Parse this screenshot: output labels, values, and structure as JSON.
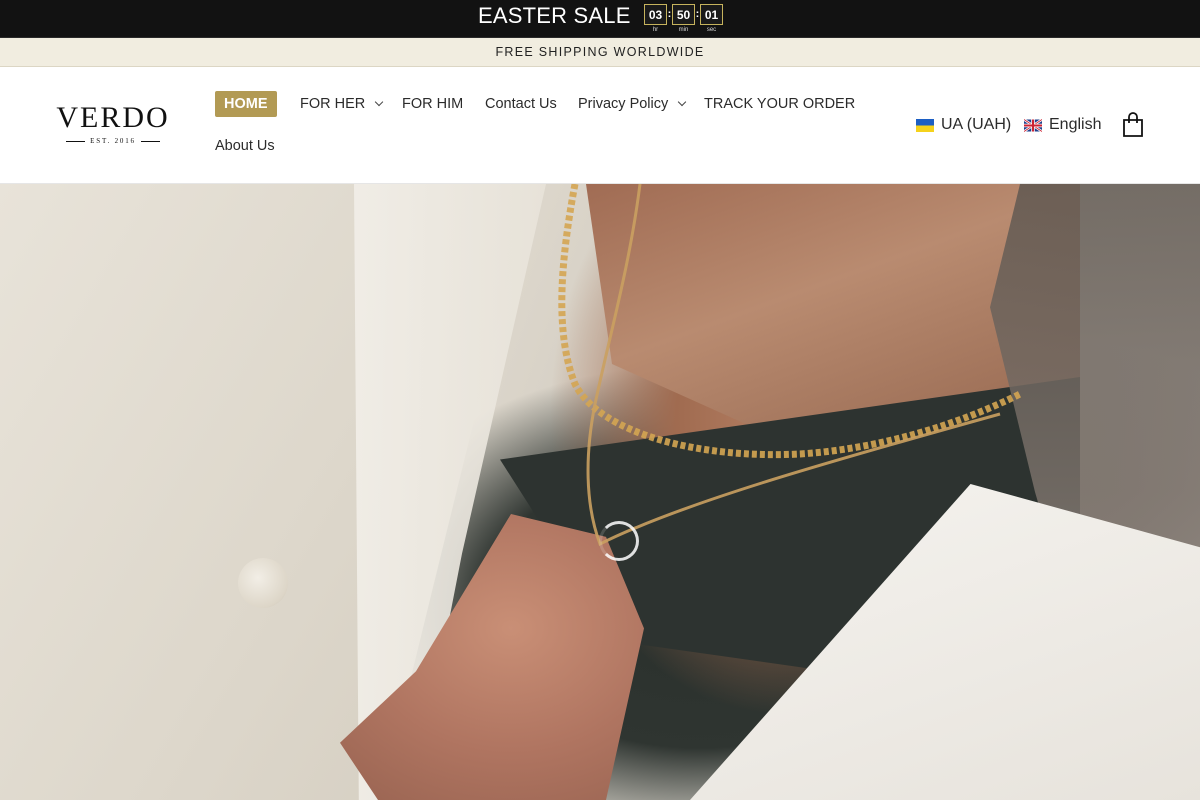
{
  "sale_bar": {
    "title": "EASTER SALE",
    "timer": [
      {
        "value": "03",
        "label": "hr"
      },
      {
        "value": "50",
        "label": "min"
      },
      {
        "value": "01",
        "label": "sec"
      }
    ],
    "separator": ":",
    "accent_color": "#c6b35d"
  },
  "announcement": {
    "text": "FREE SHIPPING WORLDWIDE"
  },
  "header": {
    "logo": {
      "wordmark": "VERDO",
      "tagline": "EST. 2016"
    },
    "nav": [
      {
        "label": "HOME",
        "active": true,
        "has_dropdown": false
      },
      {
        "label": "FOR HER",
        "active": false,
        "has_dropdown": true
      },
      {
        "label": "FOR HIM",
        "active": false,
        "has_dropdown": false
      },
      {
        "label": "Contact Us",
        "active": false,
        "has_dropdown": false
      },
      {
        "label": "Privacy Policy",
        "active": false,
        "has_dropdown": true
      },
      {
        "label": "TRACK YOUR ORDER",
        "active": false,
        "has_dropdown": false
      },
      {
        "label": "About Us",
        "active": false,
        "has_dropdown": false
      }
    ],
    "active_color": "#b29a54",
    "currency": {
      "label": "UA (UAH)",
      "flag_icon": "ukraine-flag-icon"
    },
    "language": {
      "label": "English",
      "flag_icon": "uk-flag-icon"
    },
    "cart_icon": "shopping-bag-icon"
  },
  "hero": {
    "image_subject": "man-wearing-gold-chain-necklaces",
    "loading_icon": "loading-spinner-icon"
  }
}
